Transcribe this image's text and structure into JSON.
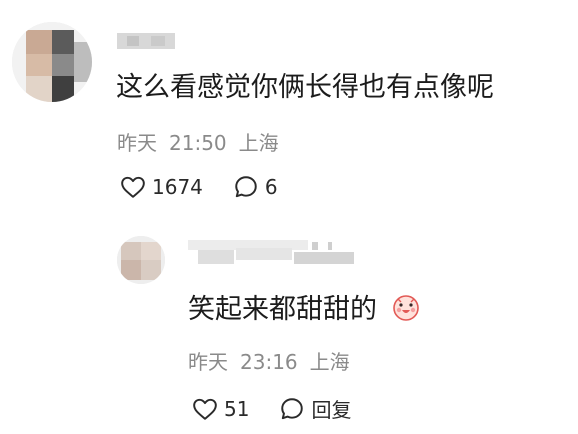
{
  "comments": [
    {
      "text": "这么看感觉你俩长得也有点像呢",
      "date": "昨天",
      "time": "21:50",
      "location": "上海",
      "likes": "1674",
      "replies": "6"
    },
    {
      "text": "笑起来都甜甜的",
      "emoji": "smiling-face-emoji",
      "date": "昨天",
      "time": "23:16",
      "location": "上海",
      "likes": "51",
      "reply_label": "回复"
    }
  ]
}
